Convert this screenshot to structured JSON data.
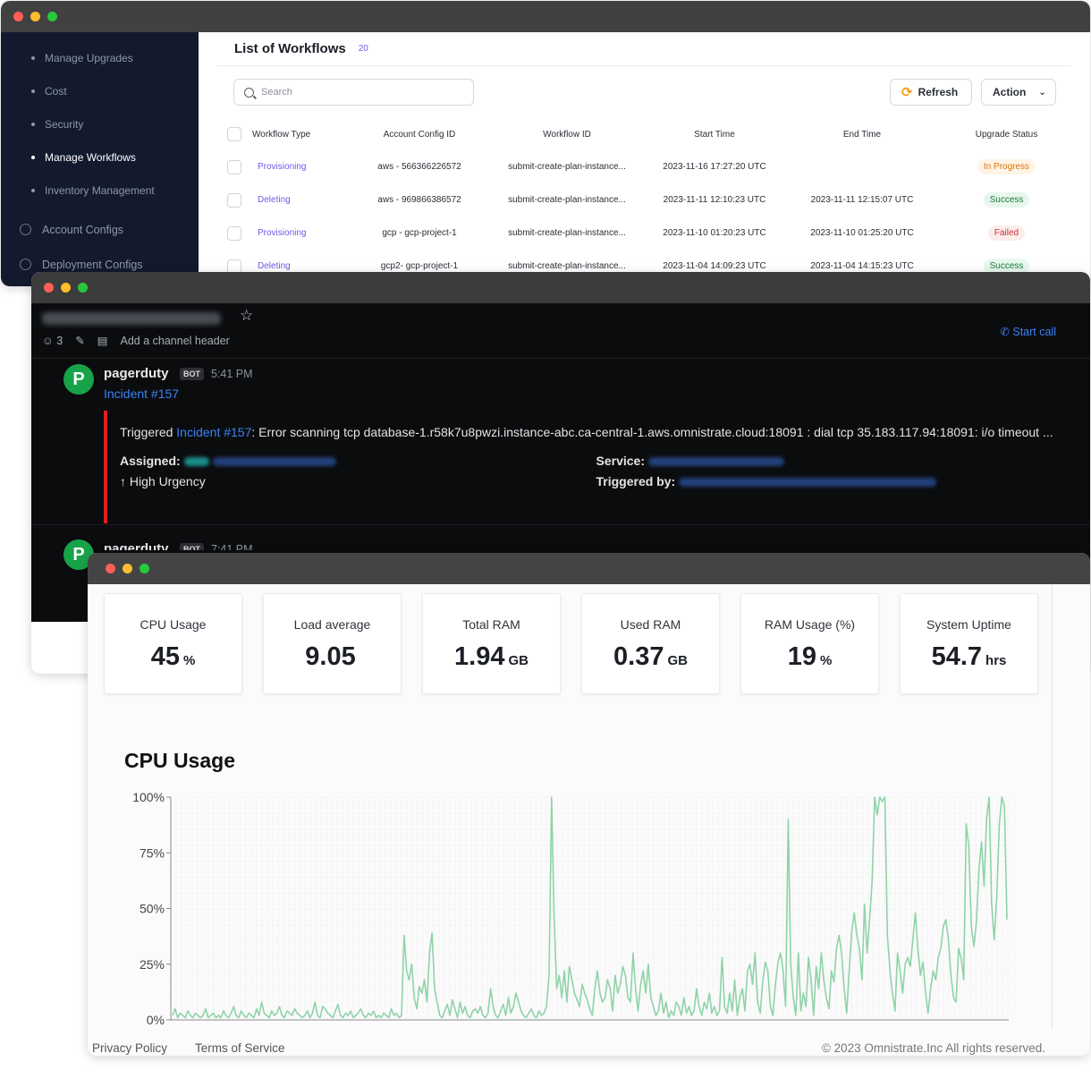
{
  "workflows_window": {
    "sidebar": {
      "items": [
        {
          "label": "Manage Upgrades"
        },
        {
          "label": "Cost"
        },
        {
          "label": "Security"
        },
        {
          "label": "Manage Workflows"
        },
        {
          "label": "Inventory Management"
        }
      ],
      "configs": [
        {
          "label": "Account Configs"
        },
        {
          "label": "Deployment Configs"
        }
      ]
    },
    "title": "List of Workflows",
    "count": "20",
    "search_placeholder": "Search",
    "refresh_label": "Refresh",
    "action_label": "Action",
    "columns": [
      "Workflow Type",
      "Account Config ID",
      "Workflow ID",
      "Start Time",
      "End Time",
      "Upgrade Status"
    ],
    "rows": [
      {
        "type": "Provisioning",
        "account": "aws - 566366226572",
        "workflow": "submit-create-plan-instance...",
        "start": "2023-11-16 17:27:20 UTC",
        "end": "",
        "status": "In Progress"
      },
      {
        "type": "Deleting",
        "account": "aws - 969866386572",
        "workflow": "submit-create-plan-instance...",
        "start": "2023-11-11 12:10:23 UTC",
        "end": "2023-11-11 12:15:07 UTC",
        "status": "Success"
      },
      {
        "type": "Provisioning",
        "account": "gcp - gcp-project-1",
        "workflow": "submit-create-plan-instance...",
        "start": "2023-11-10 01:20:23 UTC",
        "end": "2023-11-10 01:25:20 UTC",
        "status": "Failed"
      },
      {
        "type": "Deleting",
        "account": "gcp2- gcp-project-1",
        "workflow": "submit-create-plan-instance...",
        "start": "2023-11-04 14:09:23 UTC",
        "end": "2023-11-04 14:15:23 UTC",
        "status": "Success"
      }
    ]
  },
  "chat_window": {
    "member_count": "3",
    "channel_header_placeholder": "Add a channel header",
    "start_call_label": "Start call",
    "messages": [
      {
        "author": "pagerduty",
        "bot_tag": "BOT",
        "time": "5:41 PM",
        "link": "Incident #157",
        "attachment": {
          "prefix": "Triggered ",
          "incident": "Incident #157",
          "text": ": Error scanning tcp database-1.r58k7u8pwzi.instance-abc.ca-central-1.aws.omnistrate.cloud:18091 : dial tcp 35.183.117.94:18091: i/o timeout ...",
          "assigned_label": "Assigned:",
          "urgency": "↑ High Urgency",
          "service_label": "Service:",
          "triggered_by_label": "Triggered by:"
        }
      },
      {
        "author": "pagerduty",
        "bot_tag": "BOT",
        "time": "7:41 PM"
      }
    ]
  },
  "metrics_window": {
    "cards": [
      {
        "label": "CPU Usage",
        "value": "45",
        "unit": "%"
      },
      {
        "label": "Load average",
        "value": "9.05",
        "unit": ""
      },
      {
        "label": "Total RAM",
        "value": "1.94",
        "unit": "GB"
      },
      {
        "label": "Used RAM",
        "value": "0.37",
        "unit": "GB"
      },
      {
        "label": "RAM Usage (%)",
        "value": "19",
        "unit": "%"
      },
      {
        "label": "System Uptime",
        "value": "54.7",
        "unit": "hrs"
      }
    ],
    "chart_title": "CPU Usage",
    "footer": {
      "privacy": "Privacy Policy",
      "terms": "Terms of Service",
      "copyright": "© 2023 Omnistrate.Inc All rights reserved."
    }
  },
  "chart_data": {
    "type": "line",
    "title": "CPU Usage",
    "ylim": [
      0,
      100
    ],
    "yticks": [
      "0%",
      "25%",
      "50%",
      "75%",
      "100%"
    ],
    "grid": true,
    "line_color": "#8fd3a8",
    "series": [
      {
        "values": [
          2,
          5,
          1,
          3,
          2,
          1,
          4,
          2,
          1,
          3,
          2,
          1,
          2,
          5,
          1,
          2,
          3,
          1,
          2,
          1,
          4,
          2,
          1,
          3,
          6,
          2,
          1,
          4,
          2,
          1,
          3,
          2,
          1,
          5,
          2,
          8,
          3,
          2,
          1,
          4,
          2,
          3,
          6,
          2,
          1,
          4,
          3,
          2,
          5,
          3,
          2,
          1,
          2,
          4,
          1,
          3,
          8,
          2,
          1,
          6,
          5,
          3,
          2,
          1,
          4,
          7,
          2,
          1,
          3,
          2,
          4,
          1,
          2,
          3,
          5,
          2,
          1,
          3,
          2,
          4,
          1,
          2,
          1,
          3,
          2,
          1,
          5,
          2,
          3,
          1,
          2,
          38,
          22,
          18,
          25,
          10,
          5,
          15,
          12,
          18,
          8,
          30,
          39,
          14,
          8,
          2,
          1,
          4,
          7,
          2,
          9,
          5,
          1,
          8,
          3,
          6,
          2,
          1,
          4,
          5,
          3,
          6,
          2,
          1,
          3,
          14,
          6,
          2,
          1,
          4,
          7,
          2,
          10,
          3,
          6,
          12,
          8,
          4,
          2,
          1,
          3,
          5,
          2,
          1,
          4,
          2,
          3,
          6,
          20,
          100,
          45,
          14,
          20,
          10,
          22,
          8,
          24,
          18,
          12,
          9,
          6,
          16,
          12,
          9,
          5,
          2,
          14,
          22,
          12,
          8,
          10,
          18,
          14,
          4,
          20,
          12,
          16,
          24,
          20,
          10,
          8,
          30,
          14,
          4,
          16,
          22,
          12,
          25,
          10,
          6,
          2,
          4,
          12,
          3,
          8,
          1,
          4,
          2,
          8,
          6,
          2,
          10,
          3,
          6,
          2,
          4,
          14,
          6,
          2,
          8,
          5,
          12,
          3,
          6,
          2,
          4,
          28,
          6,
          3,
          12,
          4,
          18,
          2,
          10,
          14,
          4,
          22,
          25,
          16,
          30,
          8,
          3,
          17,
          26,
          22,
          6,
          2,
          16,
          26,
          30,
          22,
          6,
          90,
          25,
          10,
          2,
          30,
          4,
          12,
          6,
          28,
          18,
          2,
          24,
          14,
          30,
          18,
          10,
          5,
          22,
          17,
          32,
          38,
          30,
          14,
          3,
          22,
          40,
          48,
          38,
          32,
          18,
          52,
          30,
          45,
          62,
          100,
          92,
          100,
          98,
          100,
          38,
          22,
          12,
          4,
          30,
          22,
          12,
          25,
          28,
          24,
          36,
          48,
          32,
          20,
          26,
          12,
          3,
          14,
          22,
          18,
          28,
          32,
          42,
          45,
          36,
          20,
          10,
          8,
          32,
          28,
          18,
          88,
          78,
          42,
          33,
          44,
          68,
          80,
          60,
          90,
          100,
          52,
          36,
          55,
          88,
          100,
          96,
          45
        ]
      }
    ]
  }
}
